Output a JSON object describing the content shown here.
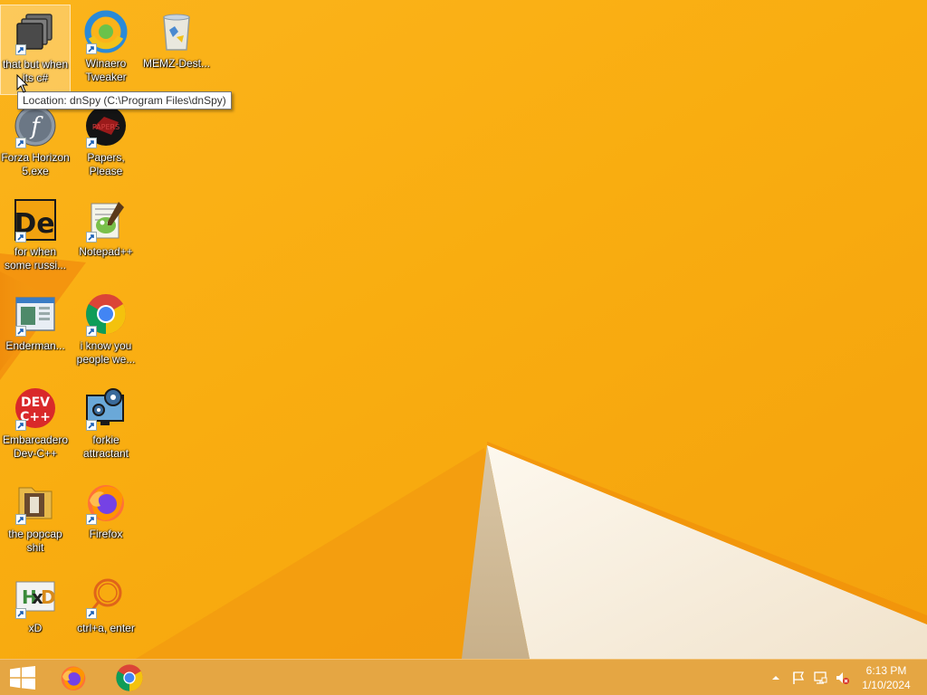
{
  "desktop": {
    "icons": [
      {
        "label": "that but when its c#",
        "icon": "dnspy-icon"
      },
      {
        "label": "Winaero Tweaker",
        "icon": "winaero-icon"
      },
      {
        "label": "MEMZ-Dest...",
        "icon": "recycle-bin-icon"
      },
      {
        "label": "Forza Horizon 5.exe",
        "icon": "flash-icon"
      },
      {
        "label": "Papers, Please",
        "icon": "papers-please-icon"
      },
      {
        "label": "for when some russi...",
        "icon": "de-icon"
      },
      {
        "label": "Notepad++",
        "icon": "notepadpp-icon"
      },
      {
        "label": "Enderman...",
        "icon": "window-icon"
      },
      {
        "label": "i know you people we...",
        "icon": "chrome-icon"
      },
      {
        "label": "Embarcadero Dev-C++",
        "icon": "devcpp-icon"
      },
      {
        "label": "forkie attractant",
        "icon": "gear-monitor-icon"
      },
      {
        "label": "the popcap shit",
        "icon": "popcap-icon"
      },
      {
        "label": "Firefox",
        "icon": "firefox-icon"
      },
      {
        "label": "xD",
        "icon": "hxd-icon"
      },
      {
        "label": "ctrl+a, enter",
        "icon": "circle-q-icon"
      }
    ],
    "tooltip": "Location: dnSpy (C:\\Program Files\\dnSpy)"
  },
  "taskbar": {
    "start_icon": "windows-logo-icon",
    "pinned": [
      {
        "name": "Firefox",
        "icon": "firefox-icon"
      },
      {
        "name": "Google Chrome",
        "icon": "chrome-icon"
      }
    ],
    "tray_icons": [
      "chevron-up-icon",
      "flag-icon",
      "network-icon",
      "volume-muted-icon"
    ],
    "time": "6:13 PM",
    "date": "1/10/2024"
  },
  "colors": {
    "wallpaper": "#f9ad10",
    "taskbar": "#e5a643",
    "accent_white": "#fbf3e6"
  }
}
